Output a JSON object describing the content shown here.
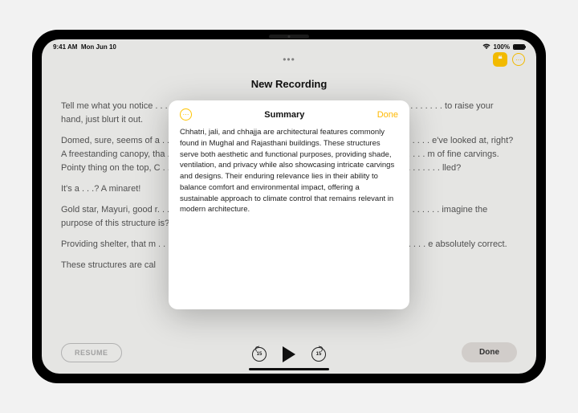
{
  "status": {
    "time": "9:41 AM",
    "date": "Mon Jun 10",
    "batt": "100%"
  },
  "page": {
    "title": "New Recording",
    "paragraphs": [
      "Tell me what you notice . . . . . . . . . . . . . . . . . . . . . . . . . . . . . . . . . . . . . . . . . . . . . . . . . . . . . . . . . . . to raise your hand, just blurt it out.",
      "Domed, sure, seems of a . . . . . . . . . . . . . . . . . . . . . . . . . . . . . . . . . . . . . . . . . . . . . . . . . . . . . . . e've looked at, right? A freestanding canopy, tha . . . . . . . . . . . . . . . . . . . . . . . . . . . . . . . . . . . . . . . . . . . . . . . . . . . . . m of fine carvings. Pointy thing on the top, C . . . . . . . . . . . . . . . . . . . . . . . . . . . . . . . . . . . . . . . . . . . . . . . . . . . . . . . . . lled?",
      "It's a . . .? A minaret!",
      "Gold star, Mayuri, good r. . . . . . . . . . . . . . . . . . . . . . . . . . . . . . . . . . . . . . . . . . . . . . . . . . . . . . . . . . imagine the purpose of this structure is?",
      "Providing shelter, that m . . . . . . . . . . . . . . . . . . . . . . . . . . . . . . . . . . . . . . . . . . . . . . . . . . . . . . . e absolutely correct.",
      "These structures are cal"
    ],
    "resume": "RESUME",
    "done": "Done",
    "skip": "15"
  },
  "modal": {
    "title": "Summary",
    "done": "Done",
    "text": "Chhatri, jali, and chhajja are architectural features commonly found in Mughal and Rajasthani buildings. These structures serve both aesthetic and functional purposes, providing shade, ventilation, and privacy while also showcasing intricate carvings and designs. Their enduring relevance lies in their ability to balance comfort and environmental impact, offering a sustainable approach to climate control that remains relevant in modern architecture."
  }
}
